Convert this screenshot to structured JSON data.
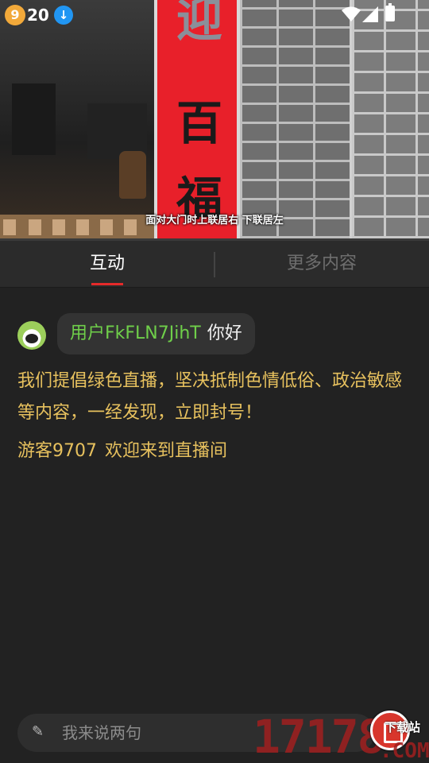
{
  "status_bar": {
    "time": "20",
    "app_badge": "9",
    "download_badge": "↓"
  },
  "video": {
    "caption": "面对大门时上联居右  下联居左",
    "couplet_chars": [
      "迎",
      "百",
      "福"
    ]
  },
  "tabs": [
    {
      "label": "互动",
      "active": true
    },
    {
      "label": "更多内容",
      "active": false
    }
  ],
  "chat": {
    "messages": [
      {
        "user": "用户FkFLN7JihT",
        "text": "你好"
      }
    ],
    "notice": "我们提倡绿色直播，坚决抵制色情低俗、政治敏感等内容，一经发现，立即封号！",
    "welcome": {
      "user": "游客9707",
      "text": "欢迎来到直播间"
    }
  },
  "input": {
    "placeholder": "我来说两句"
  },
  "watermark": {
    "number": "17178",
    "label": "下载站",
    "domain": ".COM"
  },
  "colors": {
    "background": "#222222",
    "tab_indicator": "#e52a2a",
    "username": "#6fcf4a",
    "system_text": "#e7c15e"
  }
}
